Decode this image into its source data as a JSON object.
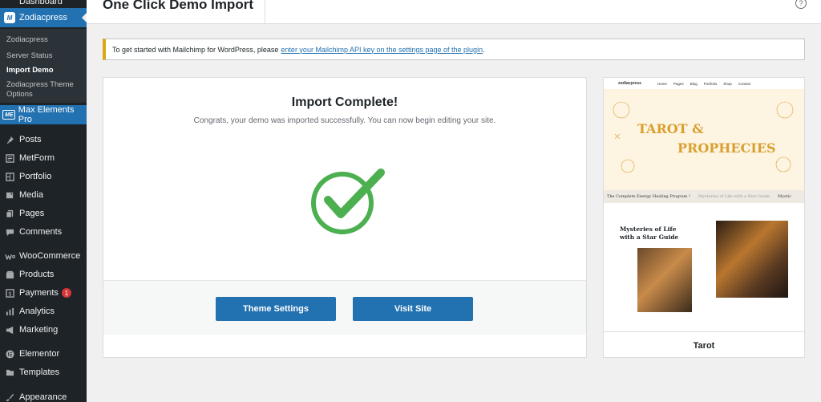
{
  "header": {
    "title": "One Click Demo Import",
    "help": "?"
  },
  "sidebar": {
    "top_item": "Dashboard",
    "active": {
      "label": "Zodiacpress",
      "logo": "M"
    },
    "submenu": [
      "Zodiacpress",
      "Server Status",
      "Import Demo",
      "Zodiacpress Theme Options"
    ],
    "max_elements": {
      "label": "Max Elements Pro",
      "logo": "ME"
    },
    "items": [
      {
        "label": "Posts",
        "icon": "pin-icon"
      },
      {
        "label": "MetForm",
        "icon": "form-icon"
      },
      {
        "label": "Portfolio",
        "icon": "portfolio-icon"
      },
      {
        "label": "Media",
        "icon": "media-icon"
      },
      {
        "label": "Pages",
        "icon": "pages-icon"
      },
      {
        "label": "Comments",
        "icon": "comment-icon"
      },
      {
        "label": "WooCommerce",
        "icon": "woo-icon"
      },
      {
        "label": "Products",
        "icon": "products-icon"
      },
      {
        "label": "Payments",
        "icon": "payments-icon",
        "badge": "1"
      },
      {
        "label": "Analytics",
        "icon": "analytics-icon"
      },
      {
        "label": "Marketing",
        "icon": "megaphone-icon"
      },
      {
        "label": "Elementor",
        "icon": "elementor-icon"
      },
      {
        "label": "Templates",
        "icon": "folder-icon"
      },
      {
        "label": "Appearance",
        "icon": "brush-icon"
      }
    ]
  },
  "notice": {
    "text": "To get started with Mailchimp for WordPress, please",
    "link": "enter your Mailchimp API key on the settings page of the plugin",
    "suffix": "."
  },
  "import": {
    "title": "Import Complete!",
    "subtitle": "Congrats, your demo was imported successfully. You can now begin editing your site.",
    "buttons": {
      "theme_settings": "Theme Settings",
      "visit_site": "Visit Site"
    }
  },
  "preview": {
    "nav_logo": "zodiacpress",
    "nav_links": [
      "Home",
      "Pages",
      "Blog",
      "Portfolio",
      "Shop",
      "Contact"
    ],
    "hero_line1": "TAROT &",
    "hero_line2": "PROPHECIES",
    "marquee": [
      "The Complete Energy Healing Program !",
      "Mysteries of Life with a Star Guide",
      "Mystic"
    ],
    "section_title": "Mysteries of Life with a Star Guide",
    "caption": "Tarot"
  },
  "colors": {
    "accent": "#2271b1",
    "sidebar": "#1d2327",
    "success": "#4caf50",
    "gold": "#d9a02f"
  }
}
